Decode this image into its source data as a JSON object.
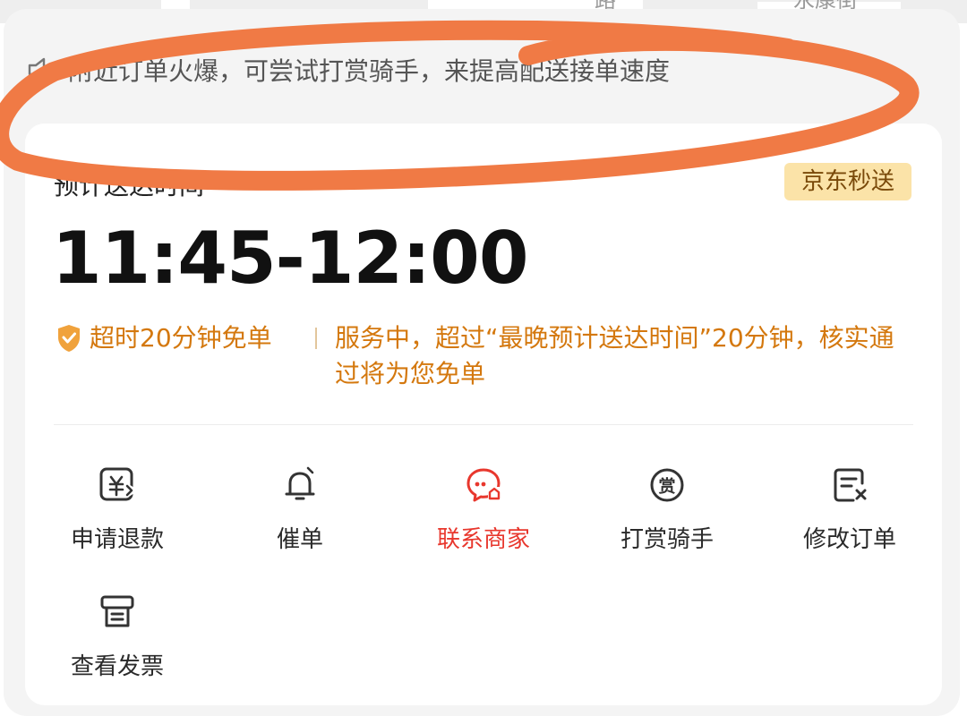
{
  "map": {
    "road_label_1": "路",
    "road_label_2": "永康街"
  },
  "notice": {
    "icon": "speaker-icon",
    "text": "附近订单火爆，可尝试打赏骑手，来提高配送接单速度"
  },
  "eta": {
    "label": "预计送达时间",
    "badge": "京东秒送",
    "time": "11:45-12:00"
  },
  "guarantee": {
    "icon": "shield-icon",
    "title": "超时20分钟免单",
    "description": "服务中，超过“最晚预计送达时间”20分钟，核实通过将为您免单"
  },
  "actions": [
    {
      "label": "申请退款",
      "icon": "refund-yuan-icon",
      "highlight": false
    },
    {
      "label": "催单",
      "icon": "bell-icon",
      "highlight": false
    },
    {
      "label": "联系商家",
      "icon": "chat-store-icon",
      "highlight": true
    },
    {
      "label": "打赏骑手",
      "icon": "reward-coin-icon",
      "highlight": false
    },
    {
      "label": "修改订单",
      "icon": "edit-order-icon",
      "highlight": false
    },
    {
      "label": "查看发票",
      "icon": "invoice-icon",
      "highlight": false
    }
  ],
  "colors": {
    "accent_orange": "#d4780e",
    "badge_bg": "#fbe3a8",
    "highlight_red": "#e8372d",
    "scribble": "#f07a45"
  }
}
